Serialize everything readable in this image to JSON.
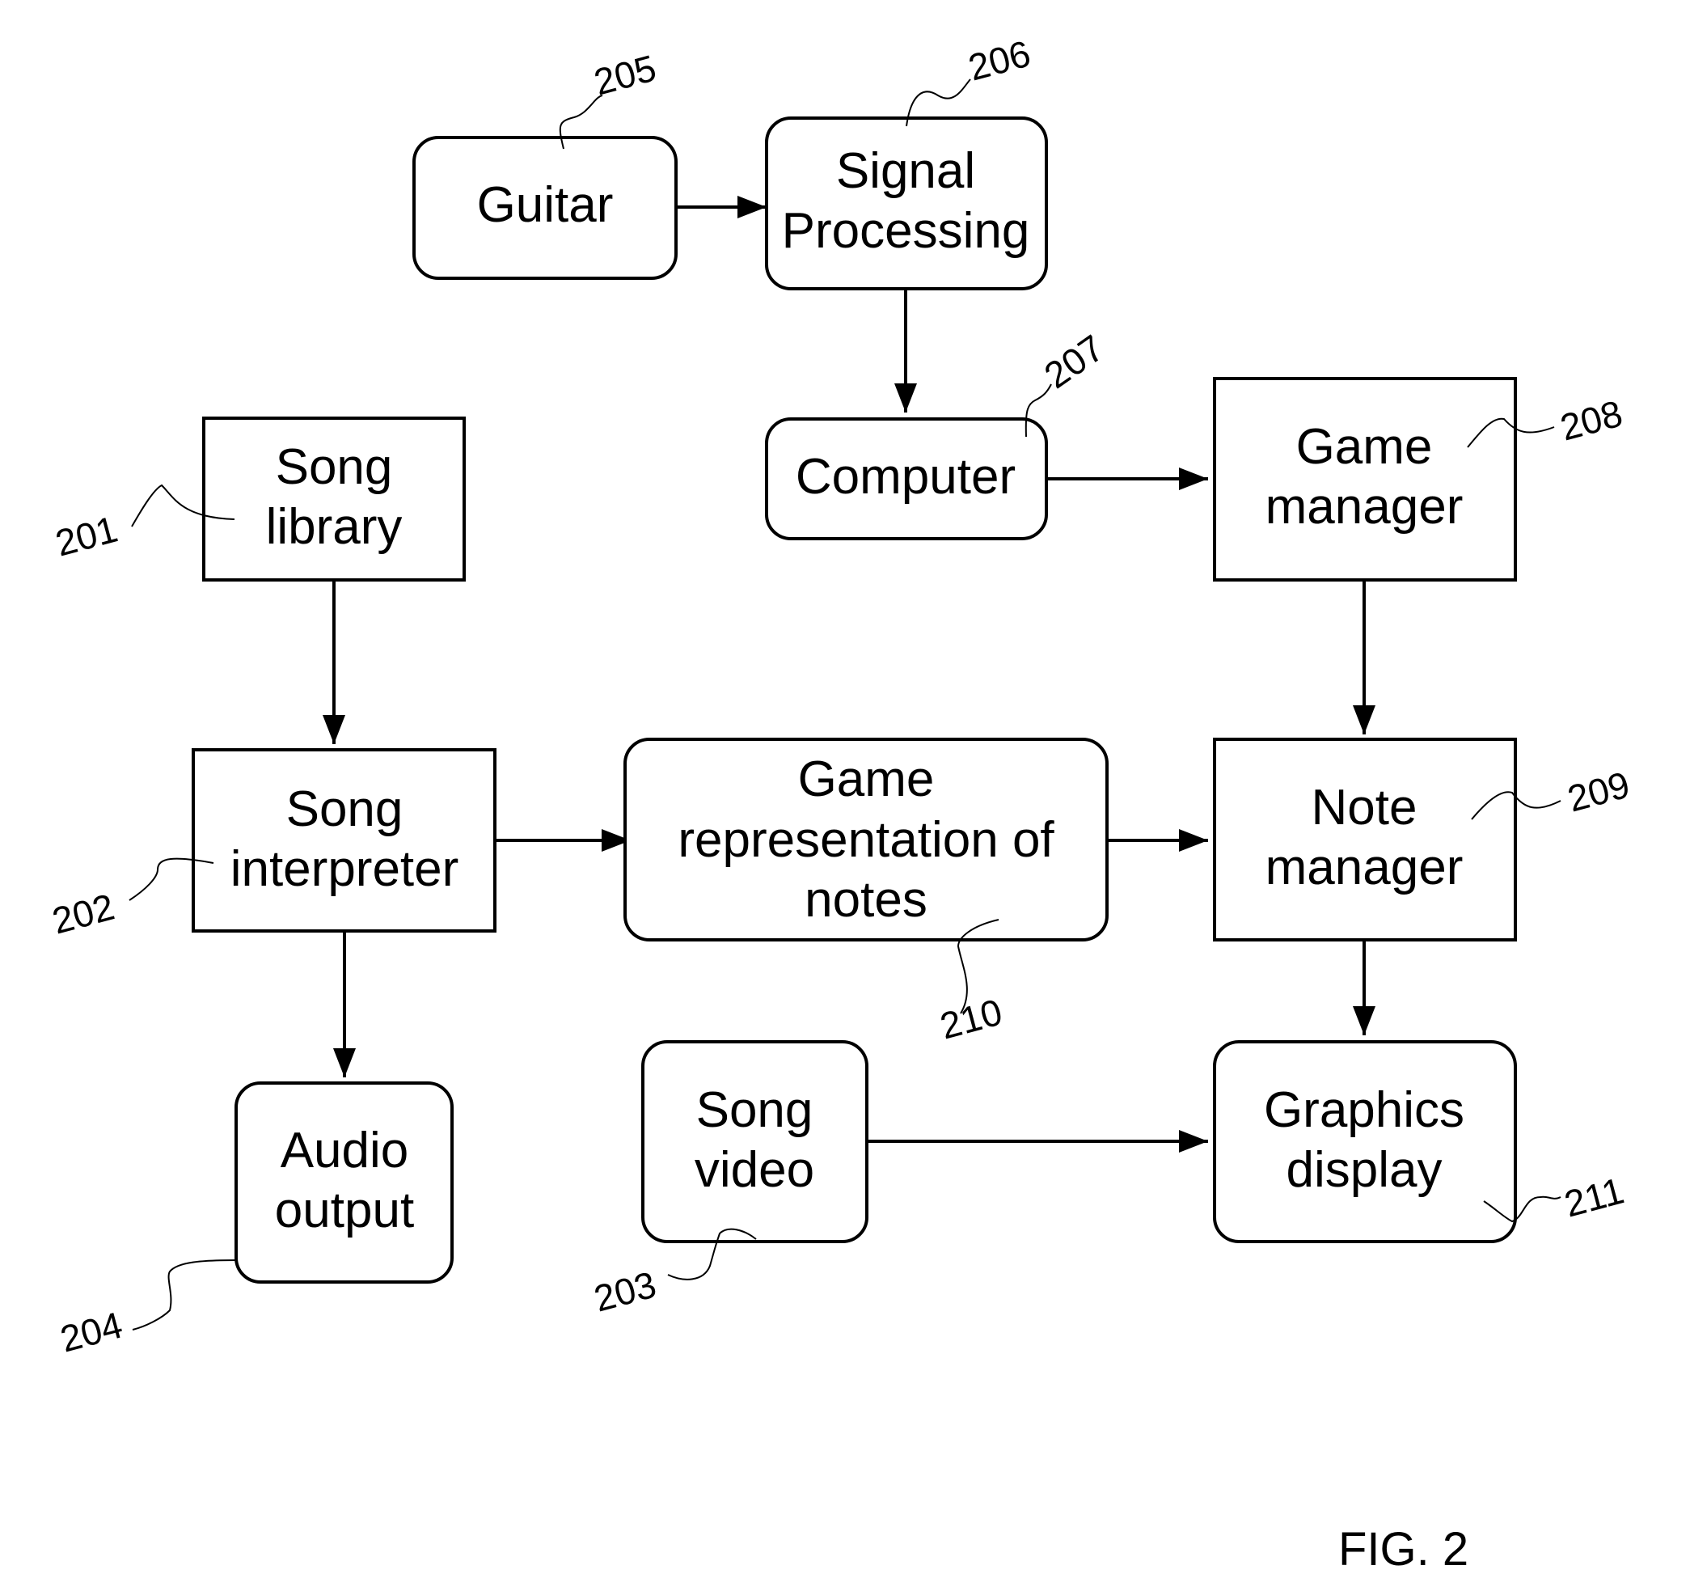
{
  "figure_label": "FIG. 2",
  "nodes": [
    {
      "id": "205",
      "label_lines": [
        "Guitar"
      ],
      "shape": "rounded"
    },
    {
      "id": "206",
      "label_lines": [
        "Signal",
        "Processing"
      ],
      "shape": "rounded"
    },
    {
      "id": "207",
      "label_lines": [
        "Computer"
      ],
      "shape": "rounded"
    },
    {
      "id": "208",
      "label_lines": [
        "Game",
        "manager"
      ],
      "shape": "rect"
    },
    {
      "id": "201",
      "label_lines": [
        "Song",
        "library"
      ],
      "shape": "rect"
    },
    {
      "id": "202",
      "label_lines": [
        "Song",
        "interpreter"
      ],
      "shape": "rect"
    },
    {
      "id": "210",
      "label_lines": [
        "Game",
        "representation of",
        "notes"
      ],
      "shape": "rounded"
    },
    {
      "id": "209",
      "label_lines": [
        "Note",
        "manager"
      ],
      "shape": "rect"
    },
    {
      "id": "204",
      "label_lines": [
        "Audio",
        "output"
      ],
      "shape": "rounded"
    },
    {
      "id": "203",
      "label_lines": [
        "Song",
        "video"
      ],
      "shape": "rounded"
    },
    {
      "id": "211",
      "label_lines": [
        "Graphics",
        "display"
      ],
      "shape": "rounded"
    }
  ],
  "edges": [
    {
      "from": "205",
      "to": "206"
    },
    {
      "from": "206",
      "to": "207"
    },
    {
      "from": "207",
      "to": "208"
    },
    {
      "from": "208",
      "to": "209"
    },
    {
      "from": "201",
      "to": "202"
    },
    {
      "from": "202",
      "to": "210"
    },
    {
      "from": "202",
      "to": "204"
    },
    {
      "from": "210",
      "to": "209"
    },
    {
      "from": "209",
      "to": "211"
    },
    {
      "from": "203",
      "to": "211"
    }
  ],
  "reference_numerals": [
    "201",
    "202",
    "203",
    "204",
    "205",
    "206",
    "207",
    "208",
    "209",
    "210",
    "211"
  ]
}
